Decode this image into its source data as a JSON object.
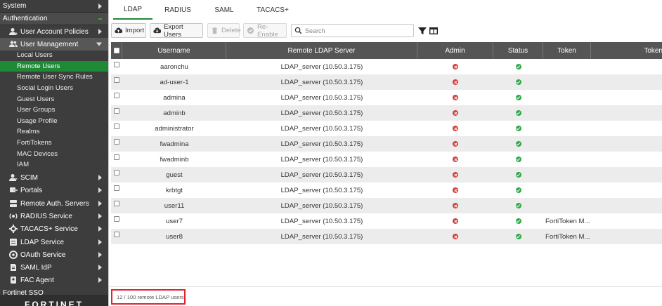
{
  "sidebar": {
    "top": [
      {
        "label": "System"
      },
      {
        "label": "Authentication"
      }
    ],
    "groups": [
      {
        "label": "User Account Policies",
        "icon": "user-gear-icon"
      },
      {
        "label": "User Management",
        "icon": "users-icon"
      },
      {
        "label": "SCIM",
        "icon": "user-sync-icon"
      },
      {
        "label": "Portals",
        "icon": "portal-icon"
      },
      {
        "label": "Remote Auth. Servers",
        "icon": "server-icon"
      },
      {
        "label": "RADIUS Service",
        "icon": "radius-icon"
      },
      {
        "label": "TACACS+ Service",
        "icon": "tacacs-icon"
      },
      {
        "label": "LDAP Service",
        "icon": "ldap-icon"
      },
      {
        "label": "OAuth Service",
        "icon": "oauth-icon"
      },
      {
        "label": "SAML IdP",
        "icon": "saml-icon"
      },
      {
        "label": "FAC Agent",
        "icon": "agent-icon"
      },
      {
        "label": "Fortinet SSO",
        "icon": ""
      }
    ],
    "user_management_items": [
      {
        "label": "Local Users"
      },
      {
        "label": "Remote Users"
      },
      {
        "label": "Remote User Sync Rules"
      },
      {
        "label": "Social Login Users"
      },
      {
        "label": "Guest Users"
      },
      {
        "label": "User Groups"
      },
      {
        "label": "Usage Profile"
      },
      {
        "label": "Realms"
      },
      {
        "label": "FortiTokens"
      },
      {
        "label": "MAC Devices"
      },
      {
        "label": "IAM"
      }
    ],
    "logo_text": "FORTINET"
  },
  "tabs": [
    {
      "label": "LDAP"
    },
    {
      "label": "RADIUS"
    },
    {
      "label": "SAML"
    },
    {
      "label": "TACACS+"
    }
  ],
  "toolbar": {
    "import_label": "Import",
    "export_label": "Export Users",
    "delete_label": "Delete",
    "reenable_label": "Re-Enable",
    "search_placeholder": "Search"
  },
  "table": {
    "columns": [
      "Username",
      "Remote LDAP Server",
      "Admin",
      "Status",
      "Token",
      "Token"
    ],
    "rows": [
      {
        "username": "aaronchu",
        "server": "LDAP_server (10.50.3.175)",
        "token": ""
      },
      {
        "username": "ad-user-1",
        "server": "LDAP_server (10.50.3.175)",
        "token": ""
      },
      {
        "username": "admina",
        "server": "LDAP_server (10.50.3.175)",
        "token": ""
      },
      {
        "username": "adminb",
        "server": "LDAP_server (10.50.3.175)",
        "token": ""
      },
      {
        "username": "administrator",
        "server": "LDAP_server (10.50.3.175)",
        "token": ""
      },
      {
        "username": "fwadmina",
        "server": "LDAP_server (10.50.3.175)",
        "token": ""
      },
      {
        "username": "fwadminb",
        "server": "LDAP_server (10.50.3.175)",
        "token": ""
      },
      {
        "username": "guest",
        "server": "LDAP_server (10.50.3.175)",
        "token": ""
      },
      {
        "username": "krbtgt",
        "server": "LDAP_server (10.50.3.175)",
        "token": ""
      },
      {
        "username": "user11",
        "server": "LDAP_server (10.50.3.175)",
        "token": ""
      },
      {
        "username": "user7",
        "server": "LDAP_server (10.50.3.175)",
        "token": "FortiToken M..."
      },
      {
        "username": "user8",
        "server": "LDAP_server (10.50.3.175)",
        "token": "FortiToken M..."
      }
    ]
  },
  "footer": {
    "count_text": "12 / 100 remote LDAP users"
  },
  "colors": {
    "accent": "#1f8a36",
    "sidebar_bg": "#3d3d3d",
    "header_bg": "#555555",
    "error": "#d43d3d",
    "ok": "#2fa84a",
    "highlight_border": "#e0232e"
  }
}
